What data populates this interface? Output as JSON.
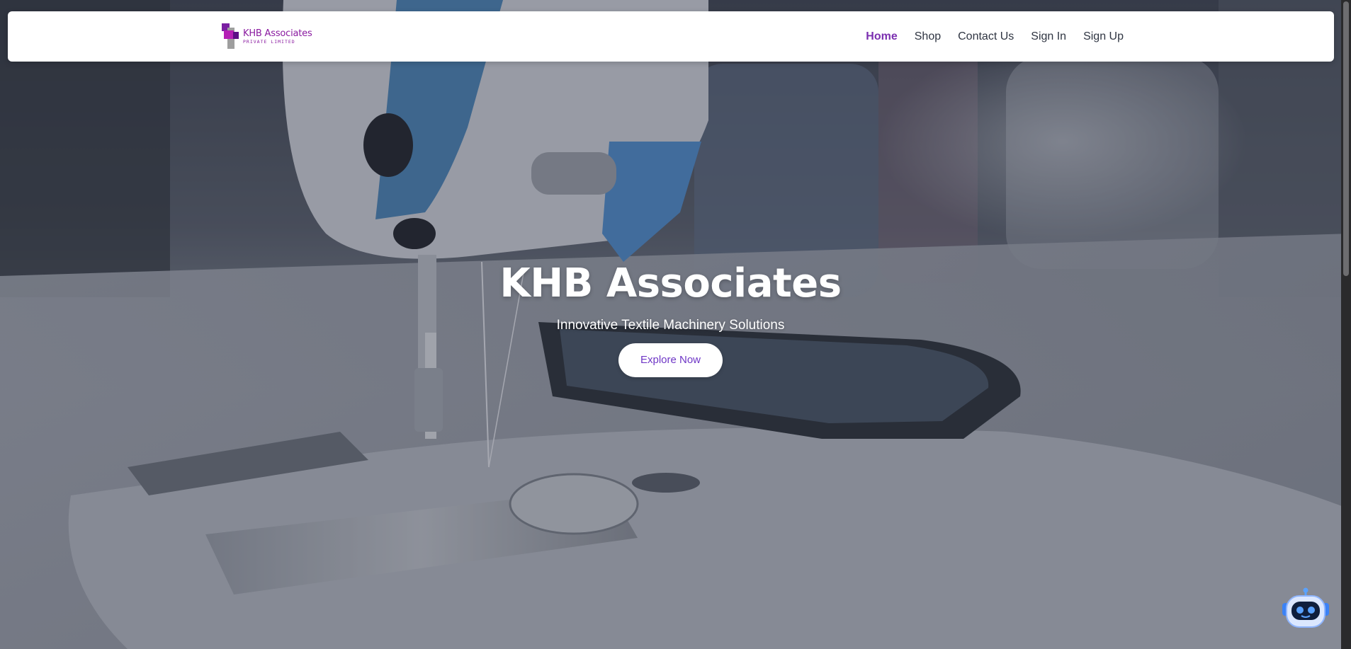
{
  "brand": {
    "name": "KHB Associates",
    "subtitle": "PRIVATE LIMITED",
    "color": "#8a1aa0"
  },
  "nav": {
    "items": [
      {
        "label": "Home",
        "active": true
      },
      {
        "label": "Shop",
        "active": false
      },
      {
        "label": "Contact Us",
        "active": false
      },
      {
        "label": "Sign In",
        "active": false
      },
      {
        "label": "Sign Up",
        "active": false
      }
    ],
    "active_color": "#7b2fb0",
    "text_color": "#2f3542"
  },
  "hero": {
    "title": "KHB Associates",
    "subtitle": "Innovative Textile Machinery Solutions",
    "cta_label": "Explore Now",
    "cta_color": "#6f37c6",
    "background_icon": "sewing-machine-photo"
  },
  "chatbot": {
    "icon": "robot-icon"
  }
}
